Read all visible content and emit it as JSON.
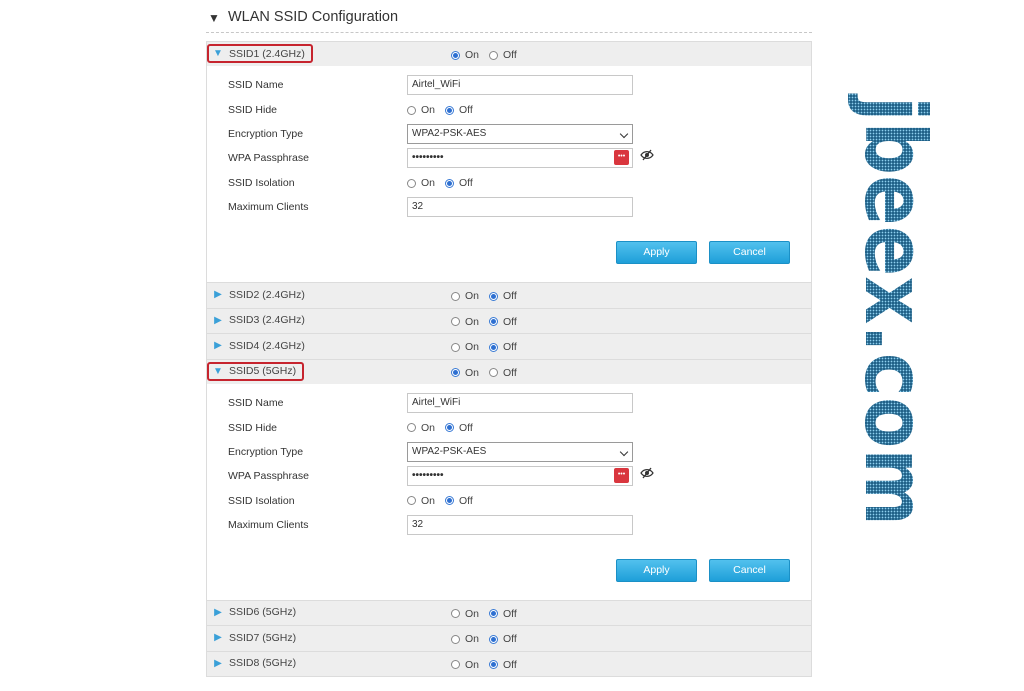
{
  "page": {
    "section_title": "WLAN SSID Configuration",
    "collapse_glyph": "▼"
  },
  "labels": {
    "ssid_name": "SSID Name",
    "ssid_hide": "SSID Hide",
    "encryption_type": "Encryption Type",
    "wpa_passphrase": "WPA Passphrase",
    "ssid_isolation": "SSID Isolation",
    "maximum_clients": "Maximum Clients",
    "on": "On",
    "off": "Off",
    "apply": "Apply",
    "cancel": "Cancel"
  },
  "ssids": [
    {
      "title": "SSID1 (2.4GHz)",
      "expanded": true,
      "highlighted": true,
      "enabled": true,
      "config": {
        "ssid_name": "Airtel_WiFi",
        "ssid_hide": "Off",
        "encryption_type": "WPA2-PSK-AES",
        "wpa_passphrase": "•••••••••",
        "ssid_isolation": "Off",
        "maximum_clients": "32"
      }
    },
    {
      "title": "SSID2 (2.4GHz)",
      "expanded": false,
      "highlighted": false,
      "enabled": false
    },
    {
      "title": "SSID3 (2.4GHz)",
      "expanded": false,
      "highlighted": false,
      "enabled": false
    },
    {
      "title": "SSID4 (2.4GHz)",
      "expanded": false,
      "highlighted": false,
      "enabled": false
    },
    {
      "title": "SSID5 (5GHz)",
      "expanded": true,
      "highlighted": true,
      "enabled": true,
      "config": {
        "ssid_name": "Airtel_WiFi",
        "ssid_hide": "Off",
        "encryption_type": "WPA2-PSK-AES",
        "wpa_passphrase": "•••••••••",
        "ssid_isolation": "Off",
        "maximum_clients": "32"
      }
    },
    {
      "title": "SSID6 (5GHz)",
      "expanded": false,
      "highlighted": false,
      "enabled": false
    },
    {
      "title": "SSID7 (5GHz)",
      "expanded": false,
      "highlighted": false,
      "enabled": false
    },
    {
      "title": "SSID8 (5GHz)",
      "expanded": false,
      "highlighted": false,
      "enabled": false
    }
  ],
  "watermark": {
    "text": "jbeex.com",
    "color": "#2e7fa8"
  },
  "colors": {
    "accent_blue": "#1e9fd9",
    "highlight_red": "#c6242e",
    "header_gray": "#eeeeee"
  },
  "icons": {
    "expanded": "triangle-down-icon",
    "collapsed": "triangle-right-icon",
    "password_generator": "key-icon",
    "show_password": "eye-slash-icon"
  }
}
